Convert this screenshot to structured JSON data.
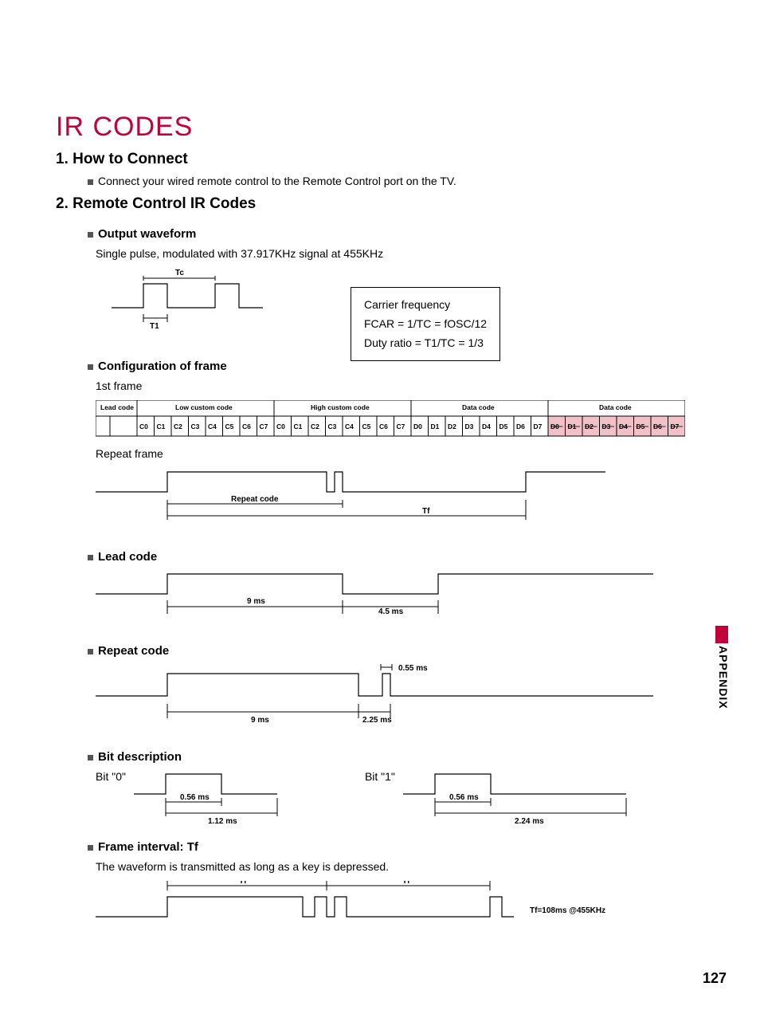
{
  "title": "IR CODES",
  "section1": {
    "heading": "1. How to Connect",
    "text": "Connect your wired remote control to the Remote Control port on the TV."
  },
  "section2": {
    "heading": "2. Remote Control IR Codes",
    "output": {
      "heading": "Output waveform",
      "text": "Single pulse, modulated with 37.917KHz signal at 455KHz",
      "tc": "Tc",
      "t1": "T1",
      "box_title": "Carrier frequency",
      "box_line1": "FCAR = 1/TC = fOSC/12",
      "box_line2": "Duty ratio = T1/TC = 1/3"
    },
    "config": {
      "heading": "Configuration of frame",
      "first_frame": "1st frame",
      "headers": [
        "Lead code",
        "Low custom code",
        "High custom code",
        "Data code",
        "Data code"
      ],
      "bits_c": [
        "C0",
        "C1",
        "C2",
        "C3",
        "C4",
        "C5",
        "C6",
        "C7"
      ],
      "bits_d": [
        "D0",
        "D1",
        "D2",
        "D3",
        "D4",
        "D5",
        "D6",
        "D7"
      ],
      "repeat_frame": "Repeat frame",
      "repeat_code": "Repeat  code",
      "tf": "Tf"
    },
    "lead": {
      "heading": "Lead code",
      "t9": "9 ms",
      "t45": "4.5 ms"
    },
    "repeat": {
      "heading": "Repeat code",
      "t055": "0.55 ms",
      "t9": "9 ms",
      "t225": "2.25 ms"
    },
    "bitdesc": {
      "heading": "Bit description",
      "bit0": "Bit \"0\"",
      "bit1": "Bit \"1\"",
      "t056": "0.56 ms",
      "t112": "1.12 ms",
      "t224": "2.24 ms"
    },
    "frameint": {
      "heading": "Frame interval: Tf",
      "text": "The waveform is transmitted as long as a key is depressed.",
      "tf": "Tf",
      "note": "Tf=108ms @455KHz"
    }
  },
  "side_label": "APPENDIX",
  "page_number": "127"
}
